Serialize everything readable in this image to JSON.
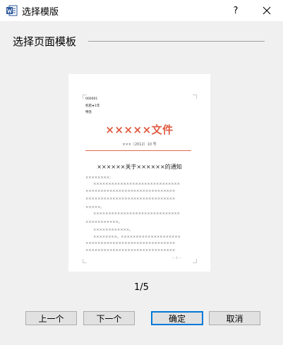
{
  "window": {
    "title": "选择模版",
    "help_label": "?",
    "app_icon": "word-icon",
    "close_icon": "close-icon"
  },
  "section": {
    "title": "选择页面模板"
  },
  "preview": {
    "header_lines": [
      "000001",
      "机密★1年",
      "特急"
    ],
    "doc_title": "×××××文件",
    "doc_number": "×××〔2012〕10 号",
    "notice_title": "××××××关于××××××的通知",
    "body_lines": [
      {
        "text": "××××××××：",
        "indent": false
      },
      {
        "text": "×××××××××××××××××××××××××××××",
        "indent": true
      },
      {
        "text": "××××××××××××××××××××××××××××××",
        "indent": false
      },
      {
        "text": "××××××××××××××××××××××××××××××",
        "indent": false
      },
      {
        "text": "×××××。",
        "indent": false
      },
      {
        "text": "×××××××××××××××××××××××××××××",
        "indent": true
      },
      {
        "text": "×××××××××××。",
        "indent": false
      },
      {
        "text": "××××××××××××。",
        "indent": true
      },
      {
        "text": "××××××××。××××××××××××××××××××",
        "indent": true
      },
      {
        "text": "××××××××××××××××××××××××××××××",
        "indent": false
      },
      {
        "text": "××××××××××××××××××××××××××××××",
        "indent": false
      }
    ],
    "footer": "— 1 —"
  },
  "page_indicator": "1/5",
  "buttons": {
    "prev": "上一个",
    "next": "下一个",
    "ok": "确定",
    "cancel": "取消"
  }
}
